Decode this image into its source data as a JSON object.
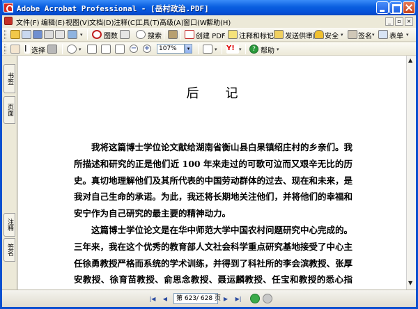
{
  "window": {
    "title": "Adobe Acrobat Professional - [岳村政治.PDF]"
  },
  "menu": [
    "文件(F)",
    "编辑(E)",
    "视图(V)",
    "文档(D)",
    "注释(C)",
    "工具(T)",
    "高级(A)",
    "窗口(W)",
    "帮助(H)"
  ],
  "toolbar1": {
    "search": "搜索",
    "create_pdf": "创建 PDF",
    "comment_markup": "注释和标记",
    "send_review": "发送供审阅",
    "security": "安全",
    "sign": "签名",
    "forms": "表单"
  },
  "toolbar2": {
    "select": "选择",
    "zoom_value": "107%",
    "help": "帮助"
  },
  "left_tabs": [
    "书签",
    "页面",
    "注释",
    "签名"
  ],
  "document": {
    "title": "后记",
    "paragraphs": [
      "我将这篇博士学位论文献给湖南省衡山县白果镇绍庄村的乡亲们。我所描述和研究的正是他们近 100 年来走过的可歌可泣而又艰辛无比的历史。真切地理解他们及其所代表的中国劳动群体的过去、现在和未来，是我对自己生命的承诺。为此，我还将长期地关注他们，并将他们的幸福和安宁作为自己研究的最主要的精神动力。",
      "这篇博士学位论文是在华中师范大学中国农村问题研究中心完成的。三年来，我在这个优秀的教育部人文社会科学重点研究基地接受了中心主任徐勇教授严格而系统的学术训练，并得到了科社所的李会滨教授、张厚安教授、徐育苗教授、俞思念教授、聂运麟教授、任宝和教授的悉心指导。"
    ]
  },
  "status": {
    "page_current": "623",
    "page_total": "628",
    "page_text": "第 623/ 628 页"
  },
  "colors": {
    "titlebar": "#0a5fe0",
    "window_frame": "#0a50d0",
    "chrome": "#ece9d8"
  }
}
